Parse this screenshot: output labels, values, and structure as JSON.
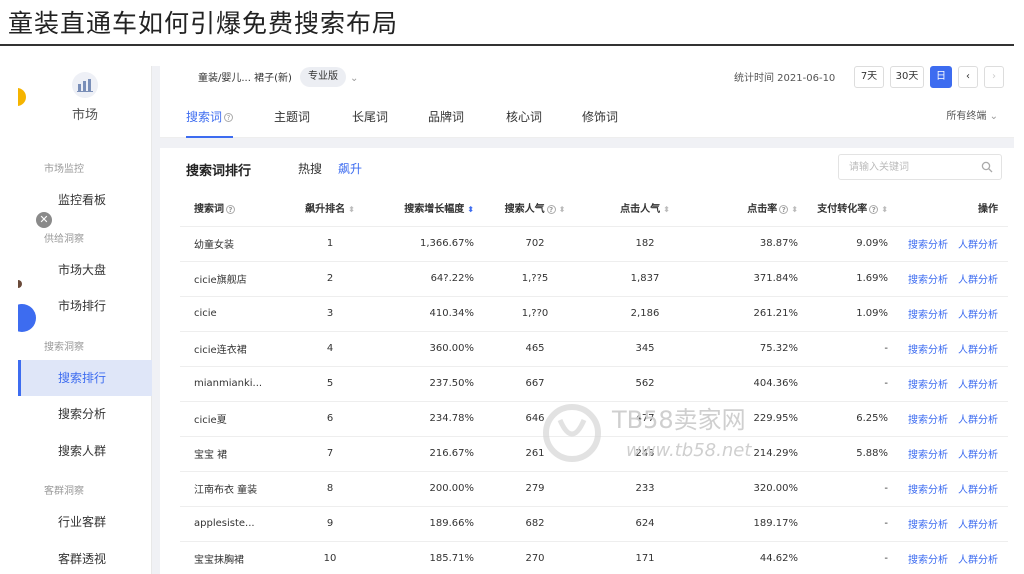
{
  "slide_title": "童装直通车如何引爆免费搜索布局",
  "sidebar": {
    "market_label": "市场",
    "groups": [
      "市场监控",
      "供给洞察",
      "搜索洞察",
      "客群洞察"
    ],
    "items": [
      {
        "label": "监控看板"
      },
      {
        "label": "市场大盘"
      },
      {
        "label": "市场排行"
      },
      {
        "label": "搜索排行"
      },
      {
        "label": "搜索分析"
      },
      {
        "label": "搜索人群"
      },
      {
        "label": "行业客群"
      },
      {
        "label": "客群透视"
      }
    ]
  },
  "topbar": {
    "category": "童装/婴儿... 裙子(新)",
    "badge": "专业版",
    "stat_time": "统计时间 2021-06-10",
    "range_7": "7天",
    "range_30": "30天",
    "range_day": "日",
    "prev": "‹",
    "next": "›"
  },
  "tabs": [
    "搜索词",
    "主题词",
    "长尾词",
    "品牌词",
    "核心词",
    "修饰词"
  ],
  "terminal": "所有终端",
  "card": {
    "title": "搜索词排行",
    "subtabs": [
      "热搜",
      "飙升"
    ],
    "search_placeholder": "请输入关键词",
    "headers": [
      "搜索词",
      "飙升排名",
      "搜索增长幅度",
      "搜索人气",
      "点击人气",
      "点击率",
      "支付转化率",
      "操作"
    ],
    "op_labels": [
      "搜索分析",
      "人群分析"
    ],
    "rows": [
      {
        "term": "幼童女装",
        "rank": "1",
        "growth": "1,366.67%",
        "search_pop": "702",
        "click_pop": "182",
        "ctr": "38.87%",
        "cvr": "9.09%"
      },
      {
        "term": "cicie旗舰店",
        "rank": "2",
        "growth": "64?.22%",
        "search_pop": "1,??5",
        "click_pop": "1,837",
        "ctr": "371.84%",
        "cvr": "1.69%"
      },
      {
        "term": "cicie",
        "rank": "3",
        "growth": "410.34%",
        "search_pop": "1,??0",
        "click_pop": "2,186",
        "ctr": "261.21%",
        "cvr": "1.09%"
      },
      {
        "term": "cicie连衣裙",
        "rank": "4",
        "growth": "360.00%",
        "search_pop": "465",
        "click_pop": "345",
        "ctr": "75.32%",
        "cvr": "-"
      },
      {
        "term": "mianmianki...",
        "rank": "5",
        "growth": "237.50%",
        "search_pop": "667",
        "click_pop": "562",
        "ctr": "404.36%",
        "cvr": "-"
      },
      {
        "term": "cicie夏",
        "rank": "6",
        "growth": "234.78%",
        "search_pop": "646",
        "click_pop": "477",
        "ctr": "229.95%",
        "cvr": "6.25%"
      },
      {
        "term": "宝宝 裙",
        "rank": "7",
        "growth": "216.67%",
        "search_pop": "261",
        "click_pop": "243",
        "ctr": "214.29%",
        "cvr": "5.88%"
      },
      {
        "term": "江南布衣 童装",
        "rank": "8",
        "growth": "200.00%",
        "search_pop": "279",
        "click_pop": "233",
        "ctr": "320.00%",
        "cvr": "-"
      },
      {
        "term": "applesiste...",
        "rank": "9",
        "growth": "189.66%",
        "search_pop": "682",
        "click_pop": "624",
        "ctr": "189.17%",
        "cvr": "-"
      },
      {
        "term": "宝宝抹胸裙",
        "rank": "10",
        "growth": "185.71%",
        "search_pop": "270",
        "click_pop": "171",
        "ctr": "44.62%",
        "cvr": "-"
      }
    ]
  },
  "watermark": {
    "name": "TB58卖家网",
    "url": "www.tb58.net"
  },
  "colors": {
    "accent": "#3d6cf0",
    "active_bg": "#dfe6f8"
  }
}
